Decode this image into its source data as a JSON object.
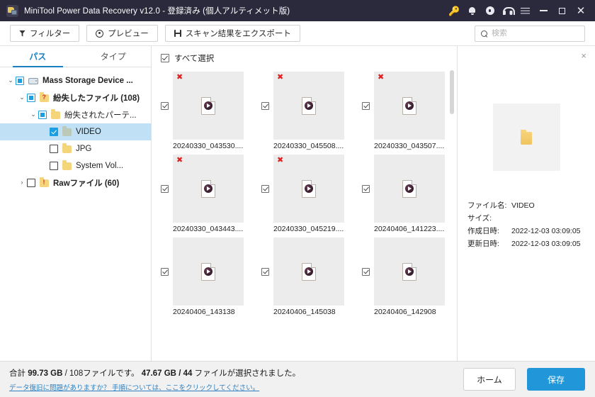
{
  "window": {
    "title": "MiniTool Power Data Recovery v12.0 - 登録済み (個人アルティメット版)",
    "logo_icon": "minitool-logo-icon",
    "icons": [
      {
        "name": "key-icon",
        "glyph": "⚒"
      },
      {
        "name": "bell-icon"
      },
      {
        "name": "disc-icon"
      },
      {
        "name": "headset-icon"
      },
      {
        "name": "menu-icon"
      },
      {
        "name": "minimize-icon"
      },
      {
        "name": "maximize-icon"
      },
      {
        "name": "close-icon",
        "glyph": "✕"
      }
    ],
    "accent_blue": "#2196d9",
    "titlebar_bg": "#2b2a3d"
  },
  "toolbar": {
    "filter_label": "フィルター",
    "preview_label": "プレビュー",
    "export_label": "スキャン結果をエクスポート",
    "search_placeholder": "検索",
    "search_value": ""
  },
  "tree": {
    "tabs": [
      {
        "label": "パス",
        "active": true
      },
      {
        "label": "タイプ",
        "active": false
      }
    ],
    "nodes": [
      {
        "label": "Mass Storage Device ...",
        "indent": 0,
        "twist": "⌄",
        "check": "partial",
        "icon": "device",
        "bold": true
      },
      {
        "label": "紛失したファイル (108)",
        "indent": 1,
        "twist": "⌄",
        "check": "partial",
        "icon": "folder-question",
        "bold": true
      },
      {
        "label": "紛失されたパーテ...",
        "indent": 2,
        "twist": "⌄",
        "check": "partial",
        "icon": "folder",
        "bold": false
      },
      {
        "label": "VIDEO",
        "indent": 3,
        "twist": "",
        "check": "checked",
        "icon": "folder-green",
        "bold": false,
        "selected": true
      },
      {
        "label": "JPG",
        "indent": 3,
        "twist": "",
        "check": "none",
        "icon": "folder",
        "bold": false
      },
      {
        "label": "System Vol...",
        "indent": 3,
        "twist": "",
        "check": "none",
        "icon": "folder",
        "bold": false
      },
      {
        "label": "Rawファイル (60)",
        "indent": 1,
        "twist": "›",
        "check": "none",
        "icon": "folder-exclaim",
        "bold": true
      }
    ]
  },
  "grid": {
    "select_all_label": "すべて選択",
    "files": [
      {
        "name": "20240330_043530....",
        "flagged": true
      },
      {
        "name": "20240330_045508....",
        "flagged": true
      },
      {
        "name": "20240330_043507....",
        "flagged": true
      },
      {
        "name": "20240330_043443....",
        "flagged": true
      },
      {
        "name": "20240330_045219....",
        "flagged": true
      },
      {
        "name": "20240406_141223....",
        "flagged": false
      },
      {
        "name": "20240406_143138",
        "flagged": false
      },
      {
        "name": "20240406_145038",
        "flagged": false
      },
      {
        "name": "20240406_142908",
        "flagged": false
      }
    ]
  },
  "detail": {
    "close_glyph": "×",
    "preview_icon": "folder-icon",
    "fields": [
      {
        "key": "ファイル名:",
        "value": "VIDEO"
      },
      {
        "key": "サイズ:",
        "value": ""
      },
      {
        "key": "作成日時:",
        "value": "2022-12-03 03:09:05"
      },
      {
        "key": "更新日時:",
        "value": "2022-12-03 03:09:05"
      }
    ]
  },
  "status": {
    "summary_prefix": "合計 ",
    "total_size": "99.73 GB",
    "total_files": " / 108ファイルです。 ",
    "selected_size": "47.67 GB",
    "selected_files": " / 44 ",
    "summary_suffix": "ファイルが選択されました。",
    "help_link": "データ復旧に問題がありますか？ 手順については、ここをクリックしてください。",
    "home_label": "ホーム",
    "save_label": "保存"
  }
}
